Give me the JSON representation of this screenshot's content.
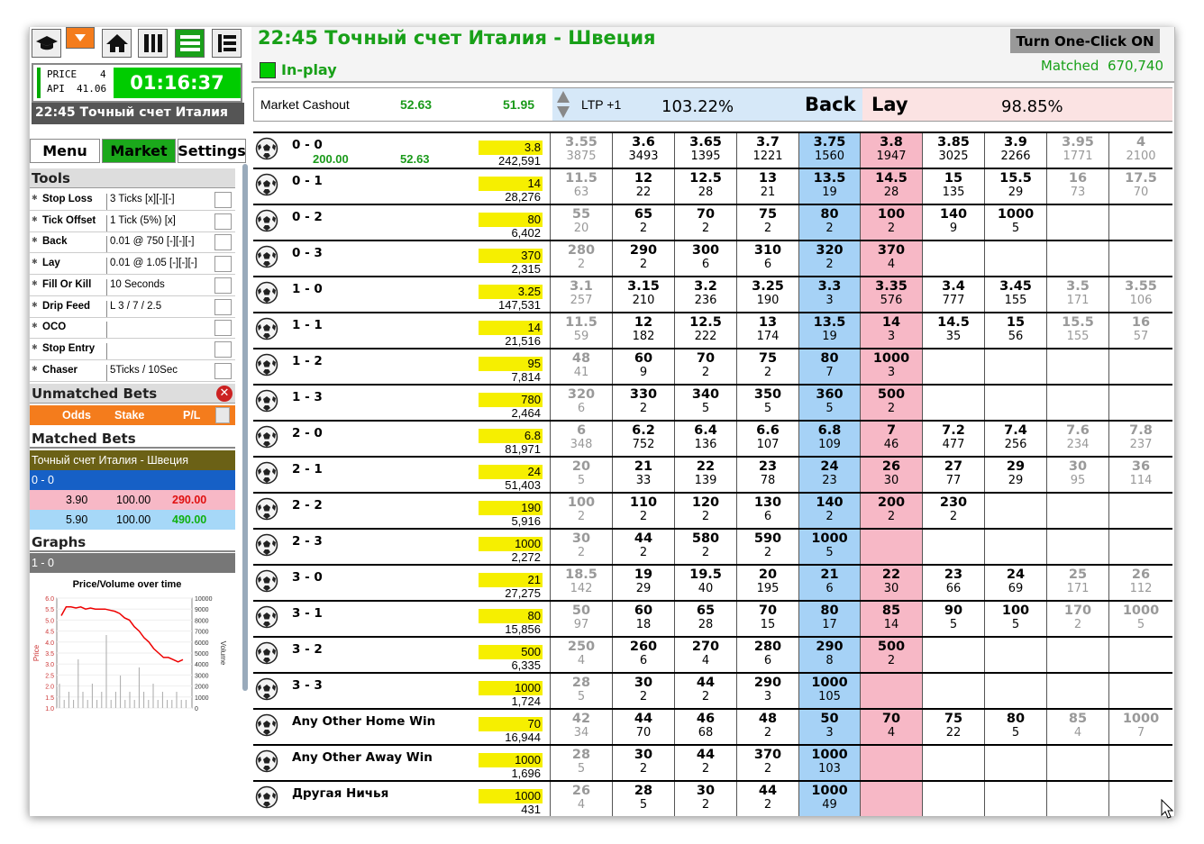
{
  "toolbar": {
    "icons": [
      "graduation-cap",
      "orange-dropdown",
      "home",
      "columns",
      "list-green",
      "list"
    ]
  },
  "price_panel": {
    "price_label": "PRICE",
    "price_value": "4",
    "api_label": "API",
    "api_value": "41.06",
    "timer": "01:16:37"
  },
  "event_short": "22:45 Точный счет Италия",
  "nav": {
    "menu": "Menu",
    "market": "Market",
    "settings": "Settings"
  },
  "tools": {
    "header": "Tools",
    "items": [
      {
        "name": "Stop Loss",
        "value": "3 Ticks [x][-][-]"
      },
      {
        "name": "Tick Offset",
        "value": "1 Tick (5%) [x]"
      },
      {
        "name": "Back",
        "value": "0.01 @ 750 [-][-][-]"
      },
      {
        "name": "Lay",
        "value": "0.01 @ 1.05 [-][-][-]"
      },
      {
        "name": "Fill Or Kill",
        "value": "10 Seconds"
      },
      {
        "name": "Drip Feed",
        "value": "L 3 / 7 / 2.5"
      },
      {
        "name": "OCO",
        "value": ""
      },
      {
        "name": "Stop Entry",
        "value": ""
      },
      {
        "name": "Chaser",
        "value": "5Ticks / 10Sec"
      }
    ]
  },
  "unmatched": {
    "header": "Unmatched Bets",
    "cols": [
      "Odds",
      "Stake",
      "P/L"
    ]
  },
  "matched_bets": {
    "header": "Matched Bets",
    "market": "Точный счет Италия - Швеция",
    "selection": "0 - 0",
    "rows": [
      {
        "odds": "3.90",
        "stake": "100.00",
        "pl": "290.00",
        "type": "lay"
      },
      {
        "odds": "5.90",
        "stake": "100.00",
        "pl": "490.00",
        "type": "back"
      }
    ]
  },
  "graphs": {
    "header": "Graphs",
    "selection": "1 - 0",
    "chart_title": "Price/Volume over time",
    "ylabel": "Price",
    "y2label": "Volume",
    "yticks": [
      "6.0",
      "5.5",
      "5.0",
      "4.5",
      "4.0",
      "3.5",
      "3.0",
      "2.5",
      "2.0",
      "1.5",
      "1.0"
    ],
    "y2ticks": [
      "10000",
      "9000",
      "8000",
      "7000",
      "6000",
      "5000",
      "4000",
      "3000",
      "2000",
      "1000",
      "0"
    ]
  },
  "chart_data": {
    "type": "line",
    "title": "Price/Volume over time",
    "ylabel": "Price",
    "y2label": "Volume",
    "ylim": [
      1.0,
      6.0
    ],
    "y2lim": [
      0,
      10000
    ],
    "series": [
      {
        "values": [
          5.2,
          5.6,
          5.6,
          5.55,
          5.6,
          5.5,
          5.55,
          5.5,
          5.5,
          5.5,
          5.45,
          5.4,
          5.3,
          5.1,
          5.0,
          4.7,
          4.5,
          4.2,
          4.0,
          3.7,
          3.5,
          3.3,
          3.3,
          3.2,
          3.1,
          3.2
        ]
      }
    ]
  },
  "header": {
    "title": "22:45 Точный счет Италия - Швеция",
    "status": "In-play",
    "one_click": "Turn One-Click ON",
    "matched_label": "Matched",
    "matched_value": "670,740"
  },
  "subheader": {
    "cashout_label": "Market Cashout",
    "cashout_1": "52.63",
    "cashout_2": "51.95",
    "ltp_label": "LTP +1",
    "back_pct": "103.22%",
    "back_label": "Back",
    "lay_label": "Lay",
    "lay_pct": "98.85%"
  },
  "runners": [
    {
      "name": "0 - 0",
      "pl1": "200.00",
      "pl2": "52.63",
      "ltp": "3.8",
      "vol": "242,591",
      "cells": [
        [
          "3.55",
          "3875",
          "d"
        ],
        [
          "3.6",
          "3493",
          "n"
        ],
        [
          "3.65",
          "1395",
          "n"
        ],
        [
          "3.7",
          "1221",
          "n"
        ],
        [
          "3.75",
          "1560",
          "b"
        ],
        [
          "3.8",
          "1947",
          "l"
        ],
        [
          "3.85",
          "3025",
          "n"
        ],
        [
          "3.9",
          "2266",
          "n"
        ],
        [
          "3.95",
          "1771",
          "d"
        ],
        [
          "4",
          "2100",
          "d"
        ]
      ]
    },
    {
      "name": "0 - 1",
      "ltp": "14",
      "vol": "28,276",
      "cells": [
        [
          "11.5",
          "63",
          "d"
        ],
        [
          "12",
          "22",
          "n"
        ],
        [
          "12.5",
          "28",
          "n"
        ],
        [
          "13",
          "21",
          "n"
        ],
        [
          "13.5",
          "19",
          "b"
        ],
        [
          "14.5",
          "28",
          "l"
        ],
        [
          "15",
          "135",
          "n"
        ],
        [
          "15.5",
          "29",
          "n"
        ],
        [
          "16",
          "73",
          "d"
        ],
        [
          "17.5",
          "70",
          "d"
        ]
      ]
    },
    {
      "name": "0 - 2",
      "ltp": "80",
      "vol": "6,402",
      "cells": [
        [
          "55",
          "20",
          "d"
        ],
        [
          "65",
          "2",
          "n"
        ],
        [
          "70",
          "2",
          "n"
        ],
        [
          "75",
          "2",
          "n"
        ],
        [
          "80",
          "2",
          "b"
        ],
        [
          "100",
          "2",
          "l"
        ],
        [
          "140",
          "9",
          "n"
        ],
        [
          "1000",
          "5",
          "n"
        ],
        [
          "",
          "",
          "n"
        ],
        [
          "",
          "",
          "n"
        ]
      ]
    },
    {
      "name": "0 - 3",
      "ltp": "370",
      "vol": "2,315",
      "cells": [
        [
          "280",
          "2",
          "d"
        ],
        [
          "290",
          "2",
          "n"
        ],
        [
          "300",
          "6",
          "n"
        ],
        [
          "310",
          "6",
          "n"
        ],
        [
          "320",
          "2",
          "b"
        ],
        [
          "370",
          "4",
          "l"
        ],
        [
          "",
          "",
          "n"
        ],
        [
          "",
          "",
          "n"
        ],
        [
          "",
          "",
          "n"
        ],
        [
          "",
          "",
          "n"
        ]
      ]
    },
    {
      "name": "1 - 0",
      "ltp": "3.25",
      "vol": "147,531",
      "cells": [
        [
          "3.1",
          "257",
          "d"
        ],
        [
          "3.15",
          "210",
          "n"
        ],
        [
          "3.2",
          "236",
          "n"
        ],
        [
          "3.25",
          "190",
          "n"
        ],
        [
          "3.3",
          "3",
          "b"
        ],
        [
          "3.35",
          "576",
          "l"
        ],
        [
          "3.4",
          "777",
          "n"
        ],
        [
          "3.45",
          "155",
          "n"
        ],
        [
          "3.5",
          "171",
          "d"
        ],
        [
          "3.55",
          "106",
          "d"
        ]
      ]
    },
    {
      "name": "1 - 1",
      "ltp": "14",
      "vol": "21,516",
      "cells": [
        [
          "11.5",
          "59",
          "d"
        ],
        [
          "12",
          "182",
          "n"
        ],
        [
          "12.5",
          "222",
          "n"
        ],
        [
          "13",
          "174",
          "n"
        ],
        [
          "13.5",
          "19",
          "b"
        ],
        [
          "14",
          "3",
          "l"
        ],
        [
          "14.5",
          "35",
          "n"
        ],
        [
          "15",
          "56",
          "n"
        ],
        [
          "15.5",
          "155",
          "d"
        ],
        [
          "16",
          "57",
          "d"
        ]
      ]
    },
    {
      "name": "1 - 2",
      "ltp": "95",
      "vol": "7,814",
      "cells": [
        [
          "48",
          "41",
          "d"
        ],
        [
          "60",
          "9",
          "n"
        ],
        [
          "70",
          "2",
          "n"
        ],
        [
          "75",
          "2",
          "n"
        ],
        [
          "80",
          "7",
          "b"
        ],
        [
          "1000",
          "3",
          "l"
        ],
        [
          "",
          "",
          "n"
        ],
        [
          "",
          "",
          "n"
        ],
        [
          "",
          "",
          "n"
        ],
        [
          "",
          "",
          "n"
        ]
      ]
    },
    {
      "name": "1 - 3",
      "ltp": "780",
      "vol": "2,464",
      "cells": [
        [
          "320",
          "6",
          "d"
        ],
        [
          "330",
          "2",
          "n"
        ],
        [
          "340",
          "5",
          "n"
        ],
        [
          "350",
          "5",
          "n"
        ],
        [
          "360",
          "5",
          "b"
        ],
        [
          "500",
          "2",
          "l"
        ],
        [
          "",
          "",
          "n"
        ],
        [
          "",
          "",
          "n"
        ],
        [
          "",
          "",
          "n"
        ],
        [
          "",
          "",
          "n"
        ]
      ]
    },
    {
      "name": "2 - 0",
      "ltp": "6.8",
      "vol": "81,971",
      "cells": [
        [
          "6",
          "348",
          "d"
        ],
        [
          "6.2",
          "752",
          "n"
        ],
        [
          "6.4",
          "136",
          "n"
        ],
        [
          "6.6",
          "107",
          "n"
        ],
        [
          "6.8",
          "109",
          "b"
        ],
        [
          "7",
          "46",
          "l"
        ],
        [
          "7.2",
          "477",
          "n"
        ],
        [
          "7.4",
          "256",
          "n"
        ],
        [
          "7.6",
          "234",
          "d"
        ],
        [
          "7.8",
          "237",
          "d"
        ]
      ]
    },
    {
      "name": "2 - 1",
      "ltp": "24",
      "vol": "51,403",
      "cells": [
        [
          "20",
          "5",
          "d"
        ],
        [
          "21",
          "33",
          "n"
        ],
        [
          "22",
          "139",
          "n"
        ],
        [
          "23",
          "78",
          "n"
        ],
        [
          "24",
          "23",
          "b"
        ],
        [
          "26",
          "30",
          "l"
        ],
        [
          "27",
          "77",
          "n"
        ],
        [
          "29",
          "29",
          "n"
        ],
        [
          "30",
          "95",
          "d"
        ],
        [
          "36",
          "114",
          "d"
        ]
      ]
    },
    {
      "name": "2 - 2",
      "ltp": "190",
      "vol": "5,916",
      "cells": [
        [
          "100",
          "2",
          "d"
        ],
        [
          "110",
          "2",
          "n"
        ],
        [
          "120",
          "2",
          "n"
        ],
        [
          "130",
          "6",
          "n"
        ],
        [
          "140",
          "2",
          "b"
        ],
        [
          "200",
          "2",
          "l"
        ],
        [
          "230",
          "2",
          "n"
        ],
        [
          "",
          "",
          "n"
        ],
        [
          "",
          "",
          "n"
        ],
        [
          "",
          "",
          "n"
        ]
      ]
    },
    {
      "name": "2 - 3",
      "ltp": "1000",
      "vol": "2,272",
      "cells": [
        [
          "30",
          "2",
          "d"
        ],
        [
          "44",
          "2",
          "n"
        ],
        [
          "580",
          "2",
          "n"
        ],
        [
          "590",
          "2",
          "n"
        ],
        [
          "1000",
          "5",
          "b"
        ],
        [
          "",
          "",
          "l"
        ],
        [
          "",
          "",
          "n"
        ],
        [
          "",
          "",
          "n"
        ],
        [
          "",
          "",
          "n"
        ],
        [
          "",
          "",
          "n"
        ]
      ]
    },
    {
      "name": "3 - 0",
      "ltp": "21",
      "vol": "27,275",
      "cells": [
        [
          "18.5",
          "142",
          "d"
        ],
        [
          "19",
          "29",
          "n"
        ],
        [
          "19.5",
          "40",
          "n"
        ],
        [
          "20",
          "195",
          "n"
        ],
        [
          "21",
          "6",
          "b"
        ],
        [
          "22",
          "30",
          "l"
        ],
        [
          "23",
          "66",
          "n"
        ],
        [
          "24",
          "69",
          "n"
        ],
        [
          "25",
          "171",
          "d"
        ],
        [
          "26",
          "112",
          "d"
        ]
      ]
    },
    {
      "name": "3 - 1",
      "ltp": "80",
      "vol": "15,856",
      "cells": [
        [
          "50",
          "97",
          "d"
        ],
        [
          "60",
          "18",
          "n"
        ],
        [
          "65",
          "28",
          "n"
        ],
        [
          "70",
          "15",
          "n"
        ],
        [
          "80",
          "17",
          "b"
        ],
        [
          "85",
          "14",
          "l"
        ],
        [
          "90",
          "5",
          "n"
        ],
        [
          "100",
          "5",
          "n"
        ],
        [
          "170",
          "2",
          "d"
        ],
        [
          "1000",
          "5",
          "d"
        ]
      ]
    },
    {
      "name": "3 - 2",
      "ltp": "500",
      "vol": "6,335",
      "cells": [
        [
          "250",
          "4",
          "d"
        ],
        [
          "260",
          "6",
          "n"
        ],
        [
          "270",
          "4",
          "n"
        ],
        [
          "280",
          "6",
          "n"
        ],
        [
          "290",
          "8",
          "b"
        ],
        [
          "500",
          "2",
          "l"
        ],
        [
          "",
          "",
          "n"
        ],
        [
          "",
          "",
          "n"
        ],
        [
          "",
          "",
          "n"
        ],
        [
          "",
          "",
          "n"
        ]
      ]
    },
    {
      "name": "3 - 3",
      "ltp": "1000",
      "vol": "1,724",
      "cells": [
        [
          "28",
          "5",
          "d"
        ],
        [
          "30",
          "2",
          "n"
        ],
        [
          "44",
          "2",
          "n"
        ],
        [
          "290",
          "3",
          "n"
        ],
        [
          "1000",
          "105",
          "b"
        ],
        [
          "",
          "",
          "l"
        ],
        [
          "",
          "",
          "n"
        ],
        [
          "",
          "",
          "n"
        ],
        [
          "",
          "",
          "n"
        ],
        [
          "",
          "",
          "n"
        ]
      ]
    },
    {
      "name": "Any Other Home Win",
      "ltp": "70",
      "vol": "16,944",
      "cells": [
        [
          "42",
          "34",
          "d"
        ],
        [
          "44",
          "70",
          "n"
        ],
        [
          "46",
          "68",
          "n"
        ],
        [
          "48",
          "2",
          "n"
        ],
        [
          "50",
          "3",
          "b"
        ],
        [
          "70",
          "4",
          "l"
        ],
        [
          "75",
          "22",
          "n"
        ],
        [
          "80",
          "5",
          "n"
        ],
        [
          "85",
          "4",
          "d"
        ],
        [
          "1000",
          "7",
          "d"
        ]
      ]
    },
    {
      "name": "Any Other Away Win",
      "ltp": "1000",
      "vol": "1,696",
      "cells": [
        [
          "28",
          "5",
          "d"
        ],
        [
          "30",
          "2",
          "n"
        ],
        [
          "44",
          "2",
          "n"
        ],
        [
          "370",
          "2",
          "n"
        ],
        [
          "1000",
          "103",
          "b"
        ],
        [
          "",
          "",
          "l"
        ],
        [
          "",
          "",
          "n"
        ],
        [
          "",
          "",
          "n"
        ],
        [
          "",
          "",
          "n"
        ],
        [
          "",
          "",
          "n"
        ]
      ]
    },
    {
      "name": "Другая Ничья",
      "ltp": "1000",
      "vol": "431",
      "cells": [
        [
          "26",
          "4",
          "d"
        ],
        [
          "28",
          "5",
          "n"
        ],
        [
          "30",
          "2",
          "n"
        ],
        [
          "44",
          "2",
          "n"
        ],
        [
          "1000",
          "49",
          "b"
        ],
        [
          "",
          "",
          "l"
        ],
        [
          "",
          "",
          "n"
        ],
        [
          "",
          "",
          "n"
        ],
        [
          "",
          "",
          "n"
        ],
        [
          "",
          "",
          "n"
        ]
      ]
    }
  ],
  "colors": {
    "accent_green": "#18a018",
    "back": "#a6d2f6",
    "lay": "#f7b8c6",
    "ltp": "#f6ef00",
    "orange": "#f47c1c"
  }
}
